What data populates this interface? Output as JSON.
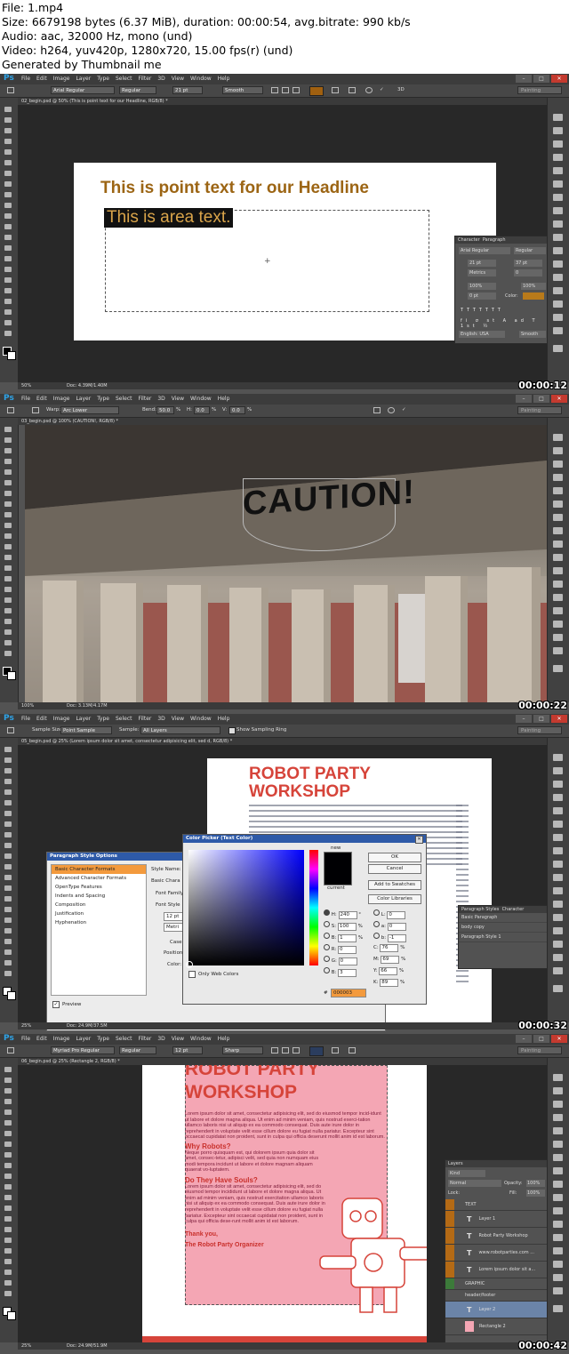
{
  "header": {
    "line1": "File: 1.mp4",
    "line2": "Size: 6679198 bytes (6.37 MiB), duration: 00:00:54, avg.bitrate: 990 kb/s",
    "line3": "Audio: aac, 32000 Hz, mono (und)",
    "line4": "Video: h264, yuv420p, 1280x720, 15.00 fps(r) (und)",
    "line5": "Generated by Thumbnail me"
  },
  "menu": {
    "logo": "Ps",
    "items": [
      "File",
      "Edit",
      "Image",
      "Layer",
      "Type",
      "Select",
      "Filter",
      "3D",
      "View",
      "Window",
      "Help"
    ]
  },
  "frames": [
    {
      "timestamp": "00:00:12",
      "tab": "02_begin.psd @ 50% (This is point text for our Headline, RGB/8) *",
      "options": {
        "font": "Arial Regular",
        "style": "Regular",
        "size": "21 pt",
        "aa": "Smooth",
        "workspace": "Painting"
      },
      "status": {
        "zoom": "50%",
        "doc": "Doc: 4.39M/1.40M"
      },
      "canvas": {
        "headline": "This is point text for our Headline",
        "area_text": "This is area text.",
        "headline_color": "#9c6514"
      },
      "character_panel": {
        "tabs": [
          "Character",
          "Paragraph"
        ],
        "font": "Arial Regular",
        "style": "Regular",
        "size": "21 pt",
        "leading": "37 pt",
        "kern": "Metrics",
        "track": "0",
        "vscale": "100%",
        "hscale": "100%",
        "baseline": "0 pt",
        "color_label": "Color:",
        "lang": "English: USA",
        "aa": "Smooth",
        "color": "#b87a1a"
      }
    },
    {
      "timestamp": "00:00:22",
      "tab": "03_begin.psd @ 100% (CAUTION!, RGB/8) *",
      "options": {
        "warp_label": "Warp:",
        "warp": "Arc Lower",
        "bend_label": "Bend:",
        "bend": "50.0",
        "h_label": "H:",
        "h": "0.0",
        "v_label": "V:",
        "v": "0.0",
        "pct": "%",
        "workspace": "Painting"
      },
      "status": {
        "zoom": "100%",
        "doc": "Doc: 3.13M/4.17M"
      },
      "canvas": {
        "word": "CAUTION!"
      }
    },
    {
      "timestamp": "00:00:32",
      "tab": "05_begin.psd @ 25% (Lorem ipsum dolor sit amet, consectetur adipisicing elit, sed d, RGB/8) *",
      "options": {
        "sample_size_label": "Sample Size:",
        "sample_size": "Point Sample",
        "sample_label": "Sample:",
        "sample": "All Layers",
        "ring": "Show Sampling Ring",
        "workspace": "Painting"
      },
      "status": {
        "zoom": "25%",
        "doc": "Doc: 24.9M/37.5M"
      },
      "doc": {
        "title1": "ROBOT PARTY",
        "title2": "WORKSHOP",
        "title_color": "#d6443a"
      },
      "para_style_dialog": {
        "title": "Paragraph Style Options",
        "items": [
          "Basic Character Formats",
          "Advanced Character Formats",
          "OpenType Features",
          "Indents and Spacing",
          "Composition",
          "Justification",
          "Hyphenation"
        ],
        "fields": [
          "Style Name:",
          "Basic Chara",
          "Font Family",
          "Font Style",
          "12 pt",
          "Metri",
          "Case",
          "Position",
          "Color:"
        ],
        "preview": "Preview"
      },
      "color_picker": {
        "title": "Color Picker (Text Color)",
        "new": "new",
        "current": "current",
        "buttons": [
          "OK",
          "Cancel",
          "Add to Swatches",
          "Color Libraries"
        ],
        "web_only": "Only Web Colors",
        "fields": [
          [
            "H:",
            "240",
            "°"
          ],
          [
            "S:",
            "100",
            "%"
          ],
          [
            "B:",
            "1",
            "%"
          ],
          [
            "R:",
            "0",
            ""
          ],
          [
            "G:",
            "0",
            ""
          ],
          [
            "B:",
            "3",
            ""
          ]
        ],
        "lab": [
          [
            "L:",
            "0"
          ],
          [
            "a:",
            "0"
          ],
          [
            "b:",
            "-1"
          ]
        ],
        "cmyk": [
          [
            "C:",
            "76",
            "%"
          ],
          [
            "M:",
            "69",
            "%"
          ],
          [
            "Y:",
            "66",
            "%"
          ],
          [
            "K:",
            "89",
            "%"
          ]
        ],
        "hex_label": "#",
        "hex": "000003"
      },
      "para_styles_panel": {
        "tabs": [
          "Paragraph Styles",
          "Character"
        ],
        "items": [
          "Basic Paragraph",
          "body copy",
          "Paragraph Style 1"
        ]
      }
    },
    {
      "timestamp": "00:00:42",
      "tab": "06_begin.psd @ 25% (Rectangle 2, RGB/8) *",
      "options": {
        "font": "Myriad Pro Regular",
        "style": "Regular",
        "size": "12 pt",
        "aa": "Sharp",
        "workspace": "Painting"
      },
      "status": {
        "zoom": "25%",
        "doc": "Doc: 24.9M/51.9M"
      },
      "doc": {
        "title1": "ROBOT PARTY",
        "title2": "WORKSHOP",
        "lorem1": "Lorem ipsum dolor sit amet, consectetur adipisicing elit, sed do eiusmod tempor incid-idunt ut labore et dolore magna aliqua. Ut enim ad minim veniam, quis nostrud exerci-tation ullamco laboris nisi ut aliquip ex ea commodo consequat. Duis aute irure dolor in reprehenderit in voluptate velit esse cillum dolore eu fugiat nulla pariatur. Excepteur sint occaecat cupidatat non proident, sunt in culpa qui officia deserunt mollit anim id est laborum.",
        "h1": "Why Robots?",
        "lorem2": "Neque porro quisquam est, qui dolorem ipsum quia dolor sit amet, consec-tetur, adipisci velit, sed quia non numquam eius modi tempora incidunt ut labore et dolore magnam aliquam quaerat vo-luptatem.",
        "h2": "Do They Have Souls?",
        "lorem3": "Lorem ipsum dolor sit amet, consectetur adipisicing elit, sed do eiusmod tempor incididunt ut labore et dolore magna aliqua. Ut enim ad minim veniam, quis nostrud exercitation ullamco laboris nisi ut aliquip ex ea commodo consequat. Duis aute irure dolor in reprehenderit in voluptate velit esse cillum dolore eu fugiat nulla pariatur. Excepteur sint occaecat cupidatat non proident, sunt in culpa qui officia dese-runt mollit anim id est laborum.",
        "thanks": "Thank you,",
        "sig": "The Robot Party Organizer",
        "bg": "#f4a6b4",
        "title_color": "#d6443a",
        "text_color": "#7b1c3a",
        "head_color": "#c9302c"
      },
      "layers_panel": {
        "title": "Layers",
        "kind": "Kind",
        "blend": "Normal",
        "opacity_label": "Opacity:",
        "opacity": "100%",
        "lock": "Lock:",
        "fill_label": "Fill:",
        "fill": "100%",
        "layers": [
          "TEXT",
          "Layer 1",
          "Robot Party Workshop",
          "www.robotparties.com ...",
          "Lorem ipsum dolor sit a...",
          "GRAPHIC",
          "header/footer",
          "Layer 2",
          "Rectangle 2"
        ]
      }
    }
  ]
}
